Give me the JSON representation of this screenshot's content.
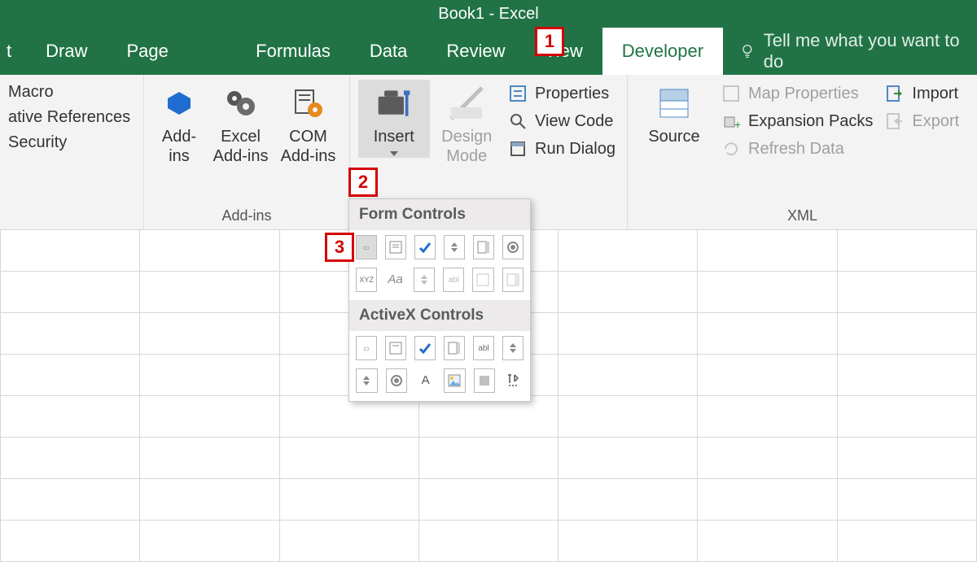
{
  "app_title": "Book1  -  Excel",
  "tabs": {
    "partial": "t",
    "draw": "Draw",
    "pageLayout": "Page Layout",
    "formulas": "Formulas",
    "data": "Data",
    "review": "Review",
    "view": "View",
    "developer": "Developer"
  },
  "tellme": "Tell me what you want to do",
  "code_group": {
    "macro": "Macro",
    "relrefs": "ative References",
    "security": "Security"
  },
  "addins": {
    "addins": "Add-\nins",
    "excel": "Excel\nAdd-ins",
    "com": "COM\nAdd-ins",
    "group_label": "Add-ins"
  },
  "controls": {
    "insert": "Insert",
    "design": "Design\nMode",
    "properties": "Properties",
    "viewcode": "View Code",
    "rundialog": "Run Dialog"
  },
  "xml": {
    "source": "Source",
    "mapprops": "Map Properties",
    "expansion": "Expansion Packs",
    "refresh": "Refresh Data",
    "import": "Import",
    "export": "Export",
    "group_label": "XML"
  },
  "dropdown": {
    "form_header": "Form Controls",
    "activex_header": "ActiveX Controls"
  },
  "callouts": {
    "c1": "1",
    "c2": "2",
    "c3": "3"
  }
}
